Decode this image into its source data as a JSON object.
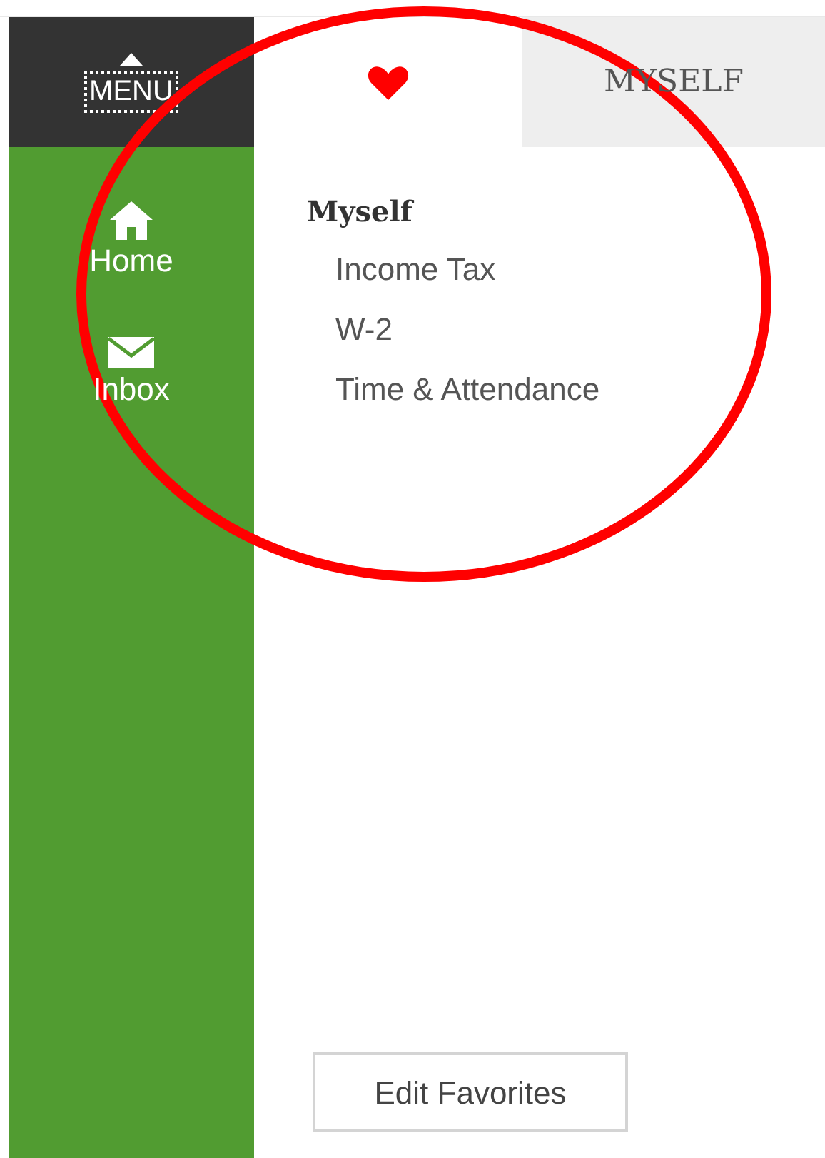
{
  "menu": {
    "label": "MENU"
  },
  "nav": [
    {
      "kind": "home",
      "label": "Home"
    },
    {
      "kind": "inbox",
      "label": "Inbox"
    }
  ],
  "tabs": [
    {
      "kind": "favorites",
      "selected": true
    },
    {
      "kind": "text",
      "label": "MYSELF",
      "selected": false
    }
  ],
  "section": {
    "heading": "Myself",
    "links": [
      "Income Tax",
      "W-2",
      "Time & Attendance"
    ]
  },
  "edit_button": "Edit Favorites",
  "annotation": {
    "kind": "ellipse",
    "color": "#ff0000"
  }
}
